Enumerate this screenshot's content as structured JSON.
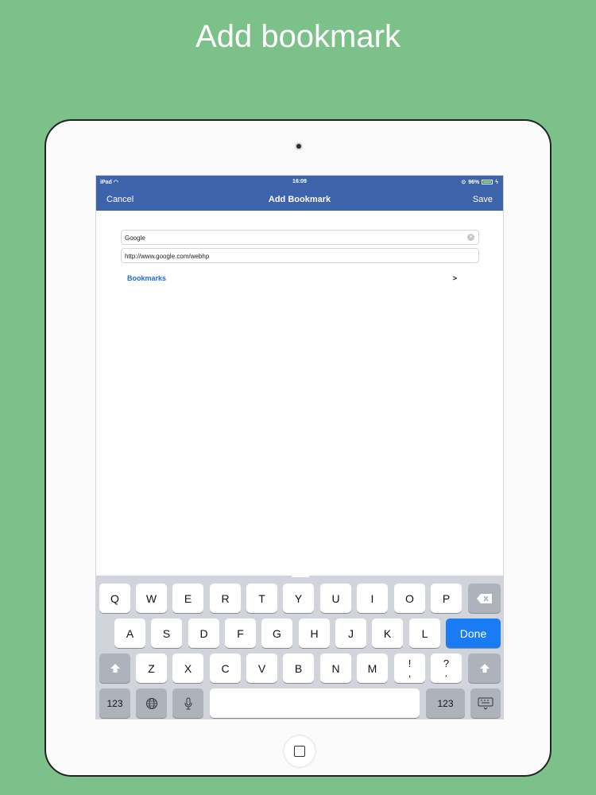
{
  "headline": "Add bookmark",
  "status_bar": {
    "device": "iPad",
    "time": "16:09",
    "battery": "96%"
  },
  "nav": {
    "cancel": "Cancel",
    "title": "Add Bookmark",
    "save": "Save"
  },
  "form": {
    "title_value": "Google",
    "url_value": "http://www.google.com/webhp",
    "folder_label": "Bookmarks",
    "folder_chevron": ">"
  },
  "keyboard": {
    "row1": [
      "Q",
      "W",
      "E",
      "R",
      "T",
      "Y",
      "U",
      "I",
      "O",
      "P"
    ],
    "row2": [
      "A",
      "S",
      "D",
      "F",
      "G",
      "H",
      "J",
      "K",
      "L"
    ],
    "row3": [
      "Z",
      "X",
      "C",
      "V",
      "B",
      "N",
      "M"
    ],
    "punct1": {
      "top": "!",
      "bottom": ","
    },
    "punct2": {
      "top": "?",
      "bottom": "."
    },
    "done": "Done",
    "numbers_left": "123",
    "numbers_right": "123",
    "space": ""
  }
}
